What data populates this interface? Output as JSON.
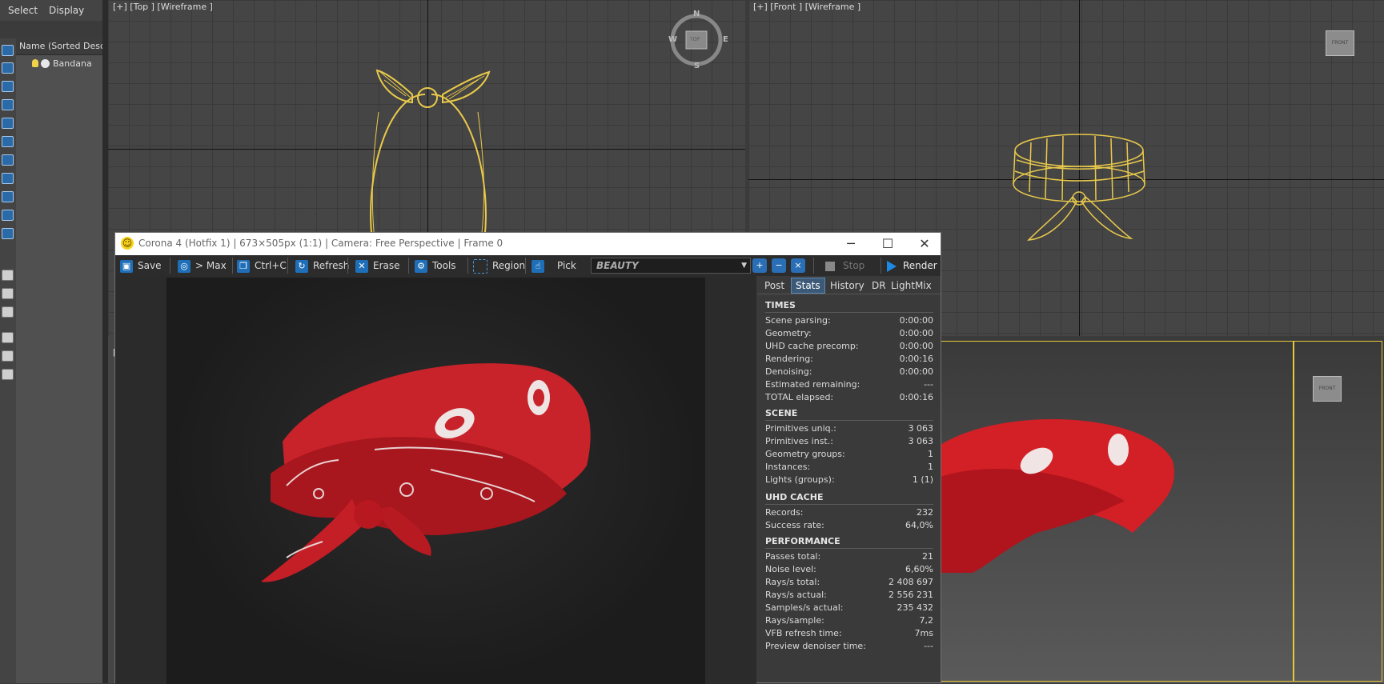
{
  "menu": {
    "select": "Select",
    "display": "Display"
  },
  "explorer": {
    "header": "Name (Sorted Descen",
    "item": "Bandana"
  },
  "viewports": {
    "top": {
      "label": "[+] [Top ] [Wireframe ]",
      "compass": [
        "N",
        "W",
        "TOP",
        "E",
        "S"
      ]
    },
    "front": {
      "label": "[+] [Front ] [Wireframe ]",
      "cube": "FRONT"
    },
    "persp": {
      "cube": "FRONT"
    },
    "left": {
      "label": "["
    }
  },
  "vfb": {
    "title": "Corona 4 (Hotfix 1) | 673×505px (1:1) | Camera: Free Perspective | Frame 0",
    "toolbar": {
      "save": "Save",
      "max": "> Max",
      "copy": "Ctrl+C",
      "refresh": "Refresh",
      "erase": "Erase",
      "tools": "Tools",
      "region": "Region",
      "pick": "Pick",
      "pass": "BEAUTY",
      "stop": "Stop",
      "render": "Render"
    },
    "tabs": [
      "Post",
      "Stats",
      "History",
      "DR",
      "LightMix"
    ],
    "active_tab": "Stats",
    "sections": [
      {
        "title": "TIMES",
        "rows": [
          {
            "k": "Scene parsing:",
            "v": "0:00:00"
          },
          {
            "k": "Geometry:",
            "v": "0:00:00"
          },
          {
            "k": "UHD cache precomp:",
            "v": "0:00:00"
          },
          {
            "k": "Rendering:",
            "v": "0:00:16"
          },
          {
            "k": "Denoising:",
            "v": "0:00:00"
          },
          {
            "k": "Estimated remaining:",
            "v": "---"
          },
          {
            "k": "TOTAL elapsed:",
            "v": "0:00:16"
          }
        ]
      },
      {
        "title": "SCENE",
        "rows": [
          {
            "k": "Primitives uniq.:",
            "v": "3 063"
          },
          {
            "k": "Primitives inst.:",
            "v": "3 063"
          },
          {
            "k": "Geometry groups:",
            "v": "1"
          },
          {
            "k": "Instances:",
            "v": "1"
          },
          {
            "k": "Lights (groups):",
            "v": "1 (1)"
          }
        ]
      },
      {
        "title": "UHD CACHE",
        "rows": [
          {
            "k": "Records:",
            "v": "232"
          },
          {
            "k": "Success rate:",
            "v": "64,0%"
          }
        ]
      },
      {
        "title": "PERFORMANCE",
        "rows": [
          {
            "k": "Passes total:",
            "v": "21"
          },
          {
            "k": "Noise level:",
            "v": "6,60%"
          },
          {
            "k": "Rays/s total:",
            "v": "2 408 697"
          },
          {
            "k": "Rays/s actual:",
            "v": "2 556 231"
          },
          {
            "k": "Samples/s actual:",
            "v": "235 432"
          },
          {
            "k": "Rays/sample:",
            "v": "7,2"
          },
          {
            "k": "VFB refresh time:",
            "v": "7ms"
          },
          {
            "k": "Preview denoiser time:",
            "v": "---"
          }
        ]
      }
    ]
  },
  "colors": {
    "wireframe": "#e9c94a",
    "bandana_red": "#c8232a",
    "accent_blue": "#1e88e5",
    "active_viewport": "#e6c83a"
  }
}
